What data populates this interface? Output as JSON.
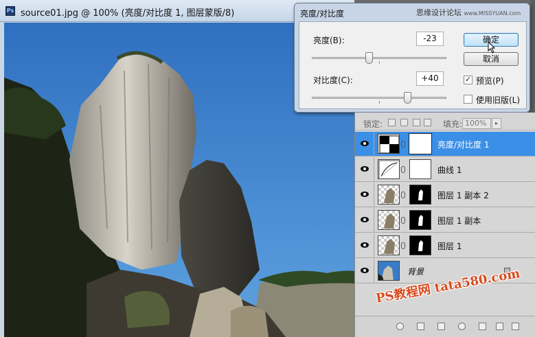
{
  "document": {
    "title": "source01.jpg @ 100% (亮度/对比度 1, 图层蒙版/8)",
    "app_icon": "Ps"
  },
  "dialog": {
    "title": "亮度/对比度",
    "watermark": "思缘设计论坛",
    "watermark_sub": "www.MISSYUAN.com",
    "brightness_label": "亮度(B):",
    "brightness_value": "-23",
    "contrast_label": "对比度(C):",
    "contrast_value": "+40",
    "ok_label": "确定",
    "cancel_label": "取消",
    "preview_label": "预览(P)",
    "preview_checked": true,
    "legacy_label": "使用旧版(L)",
    "legacy_checked": false
  },
  "layers": {
    "lock_label": "锁定:",
    "fill_label": "填充:",
    "fill_value": "100%",
    "items": [
      {
        "name": "亮度/对比度 1",
        "selected": true,
        "type": "adjustment-brightness"
      },
      {
        "name": "曲线 1",
        "selected": false,
        "type": "adjustment-curves"
      },
      {
        "name": "图层 1 副本 2",
        "selected": false,
        "type": "layer-mask"
      },
      {
        "name": "图层 1 副本",
        "selected": false,
        "type": "layer-mask"
      },
      {
        "name": "图层 1",
        "selected": false,
        "type": "layer-mask"
      },
      {
        "name": "背景",
        "selected": false,
        "type": "background",
        "locked": true
      }
    ]
  },
  "watermark_bottom": "PS教程网 tata580.com",
  "colors": {
    "selected_layer": "#3b8fe6",
    "sky": "#3a7cc8",
    "watermark": "#d74b1e"
  }
}
